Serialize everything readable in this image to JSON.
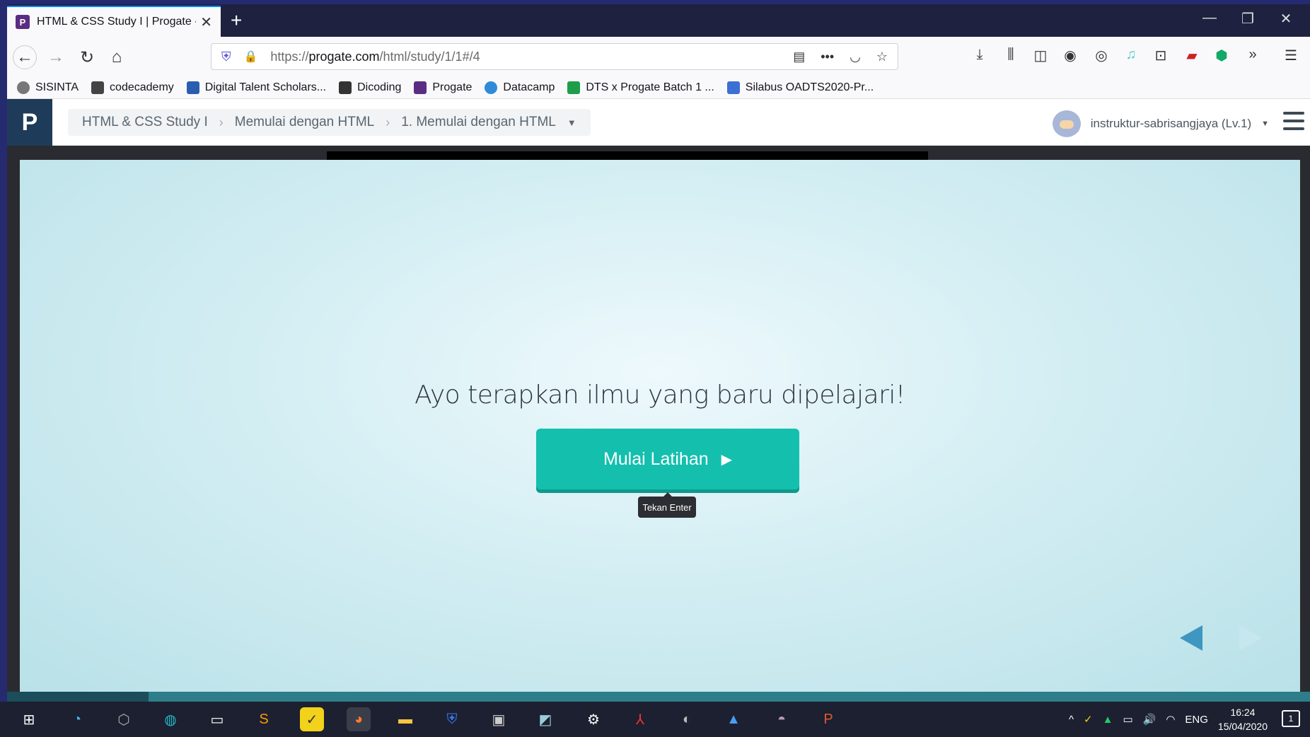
{
  "browser": {
    "tab_title": "HTML & CSS Study I | Progate -",
    "tab_favicon": "P",
    "url_scheme": "https://",
    "url_domain": "progate.com",
    "url_path": "/html/study/1/1#/4"
  },
  "bookmarks": [
    {
      "label": "SISINTA",
      "color": "#777777"
    },
    {
      "label": "codecademy",
      "color": "#444444"
    },
    {
      "label": "Digital Talent Scholars...",
      "color": "#2a5db0"
    },
    {
      "label": "Dicoding",
      "color": "#333333"
    },
    {
      "label": "Progate",
      "color": "#5b2d82"
    },
    {
      "label": "Datacamp",
      "color": "#2e8bd8"
    },
    {
      "label": "DTS x Progate Batch 1 ...",
      "color": "#1e9e4a"
    },
    {
      "label": "Silabus OADTS2020-Pr...",
      "color": "#3b6fd4"
    }
  ],
  "app": {
    "breadcrumb": [
      "HTML & CSS Study I",
      "Memulai dengan HTML",
      "1. Memulai dengan HTML"
    ],
    "user_name": "instruktur-sabrisangjaya (Lv.1)"
  },
  "slide": {
    "prompt": "Ayo terapkan ilmu yang baru dipelajari!",
    "start_button": "Mulai Latihan",
    "tooltip": "Tekan Enter"
  },
  "taskbar": {
    "language": "ENG",
    "time": "16:24",
    "date": "15/04/2020",
    "notifications": "1"
  },
  "colors": {
    "accent": "#14bfae",
    "logo_bg": "#1f3b5a"
  }
}
